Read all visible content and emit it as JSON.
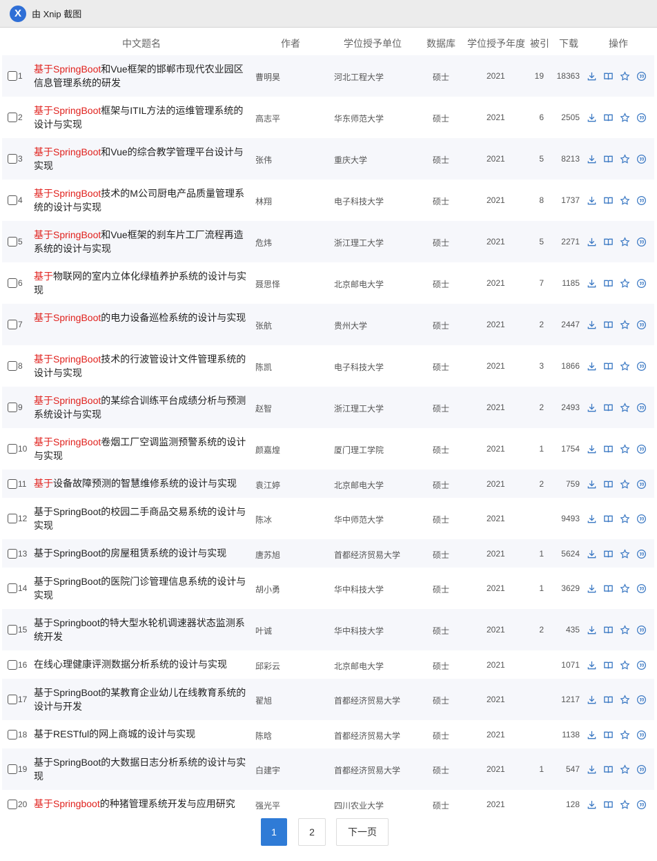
{
  "app": {
    "title": "由 Xnip 截图",
    "logo": "X"
  },
  "table": {
    "headers": {
      "title": "中文题名",
      "author": "作者",
      "unit": "学位授予单位",
      "db": "数据库",
      "year": "学位授予年度",
      "cite": "被引",
      "download": "下载",
      "ops": "操作"
    },
    "rows": [
      {
        "num": "1",
        "hl": "基于SpringBoot",
        "rest": "和Vue框架的邯郸市现代农业园区信息管理系统的研发",
        "author": "曹明昊",
        "unit": "河北工程大学",
        "db": "硕士",
        "year": "2021",
        "cite": "19",
        "download": "18363"
      },
      {
        "num": "2",
        "hl": "基于SpringBoot",
        "rest": "框架与ITIL方法的运维管理系统的设计与实现",
        "author": "高志平",
        "unit": "华东师范大学",
        "db": "硕士",
        "year": "2021",
        "cite": "6",
        "download": "2505"
      },
      {
        "num": "3",
        "hl": "基于SpringBoot",
        "rest": "和Vue的综合教学管理平台设计与实现",
        "author": "张伟",
        "unit": "重庆大学",
        "db": "硕士",
        "year": "2021",
        "cite": "5",
        "download": "8213"
      },
      {
        "num": "4",
        "hl": "基于SpringBoot",
        "rest": "技术的M公司厨电产品质量管理系统的设计与实现",
        "author": "林翔",
        "unit": "电子科技大学",
        "db": "硕士",
        "year": "2021",
        "cite": "8",
        "download": "1737"
      },
      {
        "num": "5",
        "hl": "基于SpringBoot",
        "rest": "和Vue框架的刹车片工厂流程再造系统的设计与实现",
        "author": "危炜",
        "unit": "浙江理工大学",
        "db": "硕士",
        "year": "2021",
        "cite": "5",
        "download": "2271"
      },
      {
        "num": "6",
        "hl": "基于",
        "rest": "物联网的室内立体化绿植养护系统的设计与实现",
        "author": "聂思怿",
        "unit": "北京邮电大学",
        "db": "硕士",
        "year": "2021",
        "cite": "7",
        "download": "1185"
      },
      {
        "num": "7",
        "hl": "基于SpringBoot",
        "rest": "的电力设备巡检系统的设计与实现",
        "author": "张航",
        "unit": "贵州大学",
        "db": "硕士",
        "year": "2021",
        "cite": "2",
        "download": "2447"
      },
      {
        "num": "8",
        "hl": "基于SpringBoot",
        "rest": "技术的行波管设计文件管理系统的设计与实现",
        "author": "陈凯",
        "unit": "电子科技大学",
        "db": "硕士",
        "year": "2021",
        "cite": "3",
        "download": "1866"
      },
      {
        "num": "9",
        "hl": "基于SpringBoot",
        "rest": "的某综合训练平台成绩分析与预测系统设计与实现",
        "author": "赵智",
        "unit": "浙江理工大学",
        "db": "硕士",
        "year": "2021",
        "cite": "2",
        "download": "2493"
      },
      {
        "num": "10",
        "hl": "基于SpringBoot",
        "rest": "卷烟工厂空调监测预警系统的设计与实现",
        "author": "颜嘉煌",
        "unit": "厦门理工学院",
        "db": "硕士",
        "year": "2021",
        "cite": "1",
        "download": "1754"
      },
      {
        "num": "11",
        "hl": "基于",
        "rest": "设备故障预测的智慧维修系统的设计与实现",
        "author": "袁江婷",
        "unit": "北京邮电大学",
        "db": "硕士",
        "year": "2021",
        "cite": "2",
        "download": "759"
      },
      {
        "num": "12",
        "hl": "",
        "rest": "基于SpringBoot的校园二手商品交易系统的设计与实现",
        "author": "陈冰",
        "unit": "华中师范大学",
        "db": "硕士",
        "year": "2021",
        "cite": "",
        "download": "9493"
      },
      {
        "num": "13",
        "hl": "",
        "rest": "基于SpringBoot的房屋租赁系统的设计与实现",
        "author": "唐苏旭",
        "unit": "首都经济贸易大学",
        "db": "硕士",
        "year": "2021",
        "cite": "1",
        "download": "5624"
      },
      {
        "num": "14",
        "hl": "",
        "rest": "基于SpringBoot的医院门诊管理信息系统的设计与实现",
        "author": "胡小勇",
        "unit": "华中科技大学",
        "db": "硕士",
        "year": "2021",
        "cite": "1",
        "download": "3629"
      },
      {
        "num": "15",
        "hl": "",
        "rest": "基于Springboot的特大型水轮机调速器状态监测系统开发",
        "author": "叶诚",
        "unit": "华中科技大学",
        "db": "硕士",
        "year": "2021",
        "cite": "2",
        "download": "435"
      },
      {
        "num": "16",
        "hl": "",
        "rest": "在线心理健康评测数据分析系统的设计与实现",
        "author": "邱彩云",
        "unit": "北京邮电大学",
        "db": "硕士",
        "year": "2021",
        "cite": "",
        "download": "1071"
      },
      {
        "num": "17",
        "hl": "",
        "rest": "基于SpringBoot的某教育企业幼儿在线教育系统的设计与开发",
        "author": "翟旭",
        "unit": "首都经济贸易大学",
        "db": "硕士",
        "year": "2021",
        "cite": "",
        "download": "1217"
      },
      {
        "num": "18",
        "hl": "",
        "rest": "基于RESTful的网上商城的设计与实现",
        "author": "陈晗",
        "unit": "首都经济贸易大学",
        "db": "硕士",
        "year": "2021",
        "cite": "",
        "download": "1138"
      },
      {
        "num": "19",
        "hl": "",
        "rest": "基于SpringBoot的大数据日志分析系统的设计与实现",
        "author": "白建宇",
        "unit": "首都经济贸易大学",
        "db": "硕士",
        "year": "2021",
        "cite": "1",
        "download": "547"
      },
      {
        "num": "20",
        "hl": "基于Springboot",
        "rest": "的种猪管理系统开发与应用研究",
        "author": "强光平",
        "unit": "四川农业大学",
        "db": "硕士",
        "year": "2021",
        "cite": "",
        "download": "128"
      }
    ]
  },
  "icons": [
    "download-icon",
    "read-icon",
    "favorite-icon",
    "quote-icon"
  ],
  "colors": {
    "highlight": "#e0201c",
    "accent": "#2f7bd6",
    "rowStripe": "#f6f7fb"
  },
  "pagination": {
    "current": "1",
    "page2": "2",
    "next": "下一页"
  }
}
